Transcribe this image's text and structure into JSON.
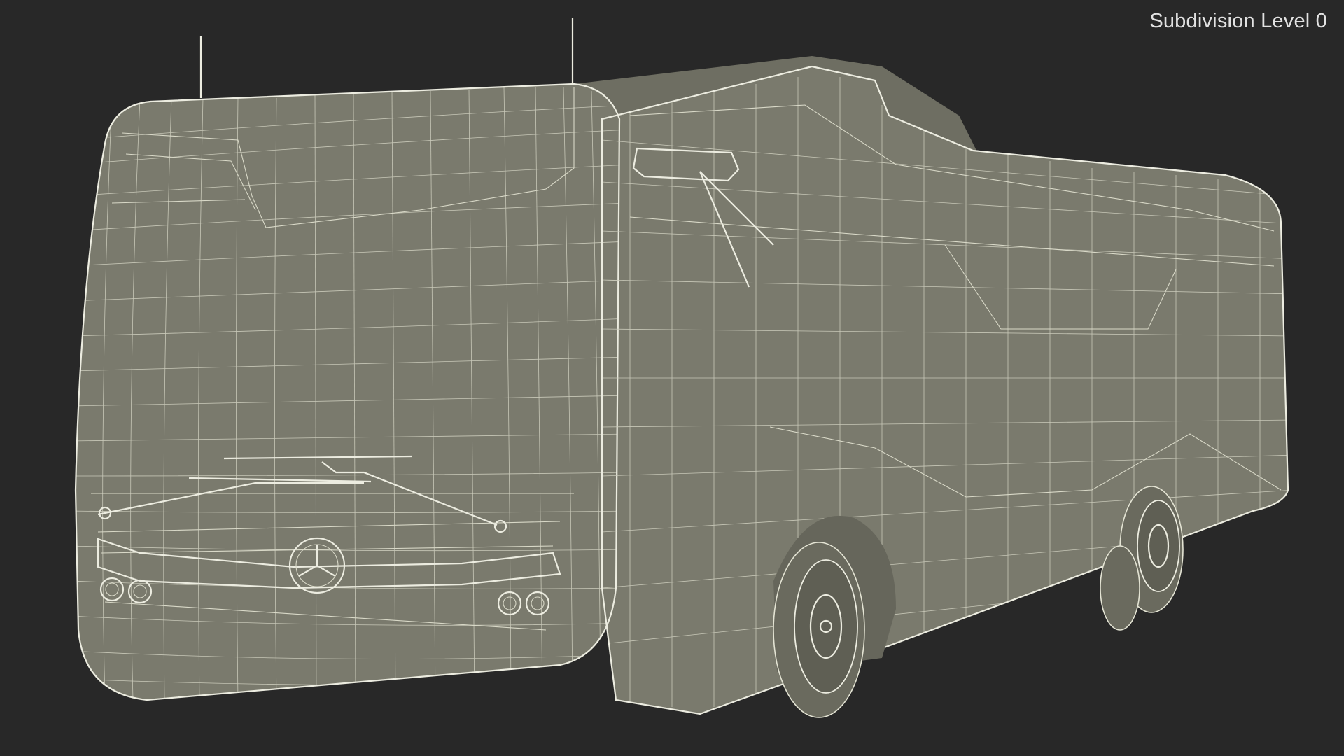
{
  "viewport": {
    "background_color": "#282828",
    "mesh_fill_color": "#7a7a6d",
    "wire_color": "#d9d9c8",
    "label": "Subdivision Level 0"
  },
  "model": {
    "name": "wireframe-bus-model"
  }
}
